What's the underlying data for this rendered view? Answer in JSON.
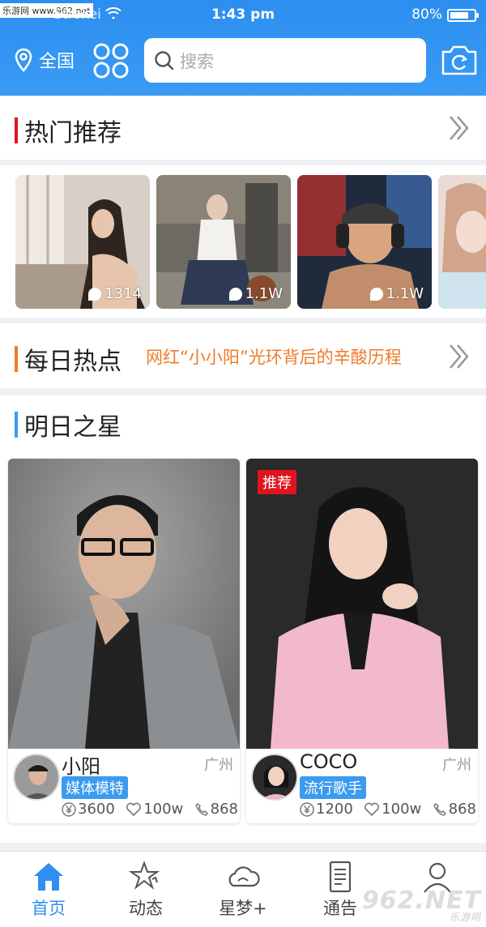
{
  "status_bar": {
    "watermark": "乐游网 www.962.net",
    "carrier": "Strokei",
    "time": "1:43 pm",
    "battery": "80%"
  },
  "header": {
    "location": "全国",
    "search_placeholder": "搜索"
  },
  "hot_section": {
    "title": "热门推荐",
    "accent": "#e0141e",
    "items": [
      {
        "count": "1314"
      },
      {
        "count": "1.1W"
      },
      {
        "count": "1.1W"
      },
      {
        "count": ""
      }
    ]
  },
  "daily_section": {
    "title": "每日热点",
    "accent": "#f07a2a",
    "headline": "网红“小小阳”光环背后的辛酸历程"
  },
  "stars_section": {
    "title": "明日之星",
    "accent": "#3b9bef",
    "cards": [
      {
        "name": "小阳",
        "city": "广州",
        "tag": "媒体模特",
        "price": "3600",
        "likes": "100w",
        "calls": "868",
        "recommended": ""
      },
      {
        "name": "COCO",
        "city": "广州",
        "tag": "流行歌手",
        "price": "1200",
        "likes": "100w",
        "calls": "868",
        "recommended": "推荐"
      }
    ]
  },
  "tabbar": {
    "tabs": [
      {
        "label": "首页",
        "icon": "home-icon",
        "active": true
      },
      {
        "label": "动态",
        "icon": "star-icon",
        "active": false
      },
      {
        "label": "星梦+",
        "icon": "cloud-icon",
        "active": false
      },
      {
        "label": "通告",
        "icon": "document-icon",
        "active": false
      },
      {
        "label": "",
        "icon": "user-icon",
        "active": false
      }
    ],
    "brand_logo": "962.NET",
    "brand_logo_sub": "乐游网"
  },
  "colors": {
    "primary": "#2f8ef0",
    "hot_accent": "#e0141e",
    "daily_accent": "#f07a2a",
    "stars_accent": "#3b9bef"
  }
}
